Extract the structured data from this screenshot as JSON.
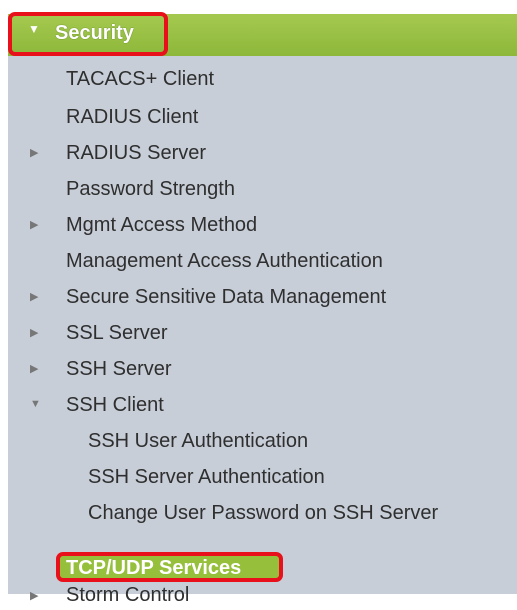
{
  "header": {
    "title": "Security"
  },
  "items": [
    "TACACS+ Client",
    "RADIUS Client",
    "RADIUS Server",
    "Password Strength",
    "Mgmt Access Method",
    "Management Access Authentication",
    "Secure Sensitive Data Management",
    "SSL Server",
    "SSH Server",
    "SSH Client",
    "SSH User Authentication",
    "SSH Server Authentication",
    "Change User Password on SSH Server",
    "TCP/UDP Services",
    "Storm Control"
  ],
  "colors": {
    "header_green": "#8db83a",
    "selected_green": "#96bf3c",
    "highlight_red": "#e8101a",
    "menu_bg": "#c7ced8"
  }
}
